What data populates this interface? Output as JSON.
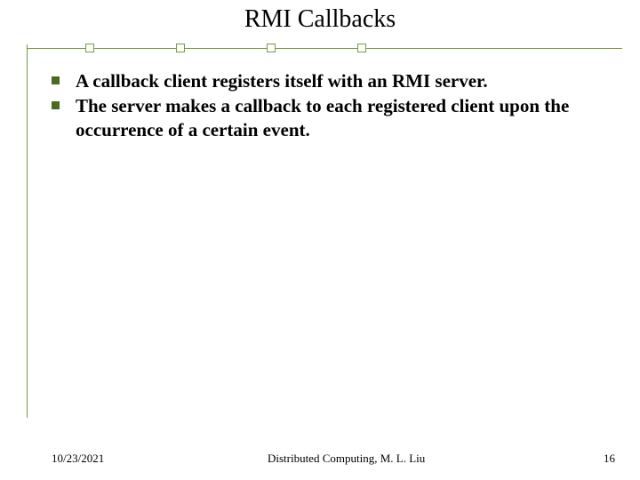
{
  "title": "RMI Callbacks",
  "bullets": [
    "A callback client registers itself with an RMI server.",
    "The server makes a callback to each registered client upon the occurrence of a certain event."
  ],
  "footer": {
    "date": "10/23/2021",
    "center": "Distributed Computing, M. L. Liu",
    "page": "16"
  },
  "colors": {
    "accent": "#7a9a3f",
    "bullet": "#4a6a1f"
  }
}
